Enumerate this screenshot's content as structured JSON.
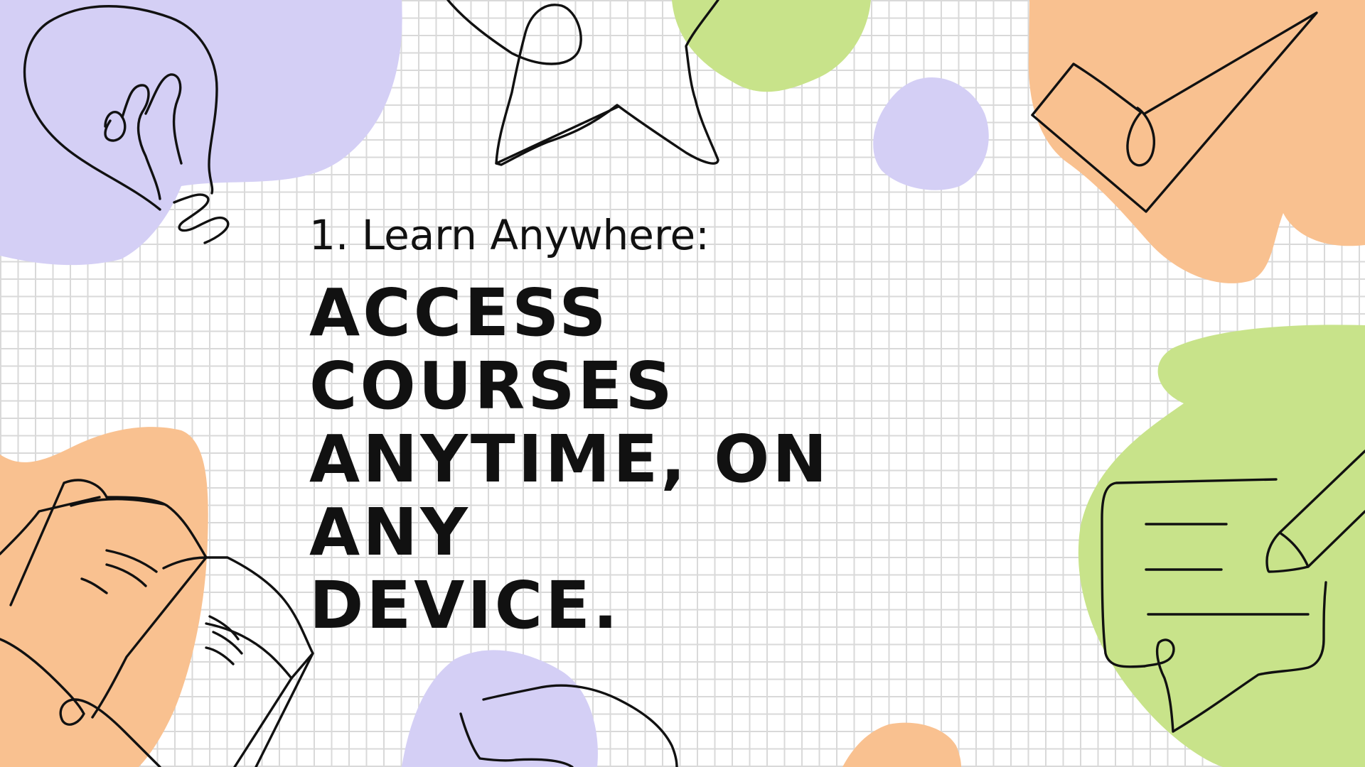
{
  "slide": {
    "subtitle": "1. Learn Anywhere:",
    "headline_lines": [
      "ACCESS COURSES",
      "ANYTIME, ON ANY",
      "DEVICE."
    ]
  },
  "colors": {
    "background": "#ffffff",
    "grid": "#d9d9d9",
    "purple_blob": "#d4cff5",
    "green_blob": "#c8e38a",
    "orange_blob": "#f9c190",
    "ink": "#111111"
  },
  "icons": [
    "lightbulb-icon",
    "star-icon",
    "checkmark-icon",
    "open-book-icon",
    "speech-bubble-pencil-icon",
    "squiggle-icon"
  ]
}
